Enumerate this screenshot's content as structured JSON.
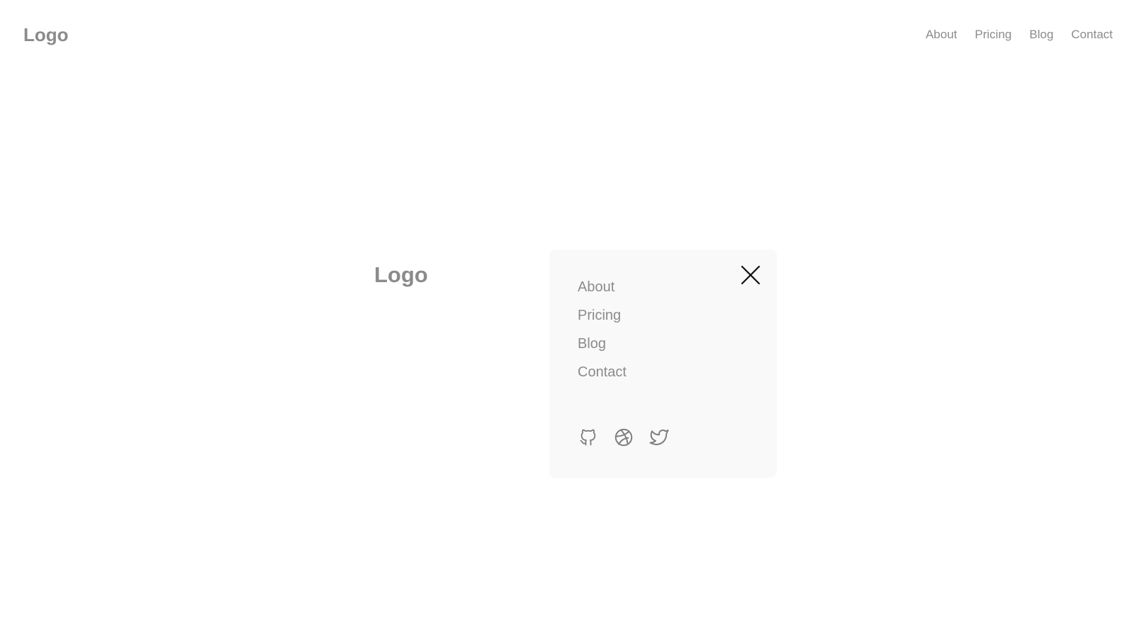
{
  "header": {
    "logo": "Logo",
    "nav": [
      {
        "label": "About"
      },
      {
        "label": "Pricing"
      },
      {
        "label": "Blog"
      },
      {
        "label": "Contact"
      }
    ]
  },
  "mobile_menu": {
    "logo": "Logo",
    "close_icon": "close-icon",
    "items": [
      {
        "label": "About"
      },
      {
        "label": "Pricing"
      },
      {
        "label": "Blog"
      },
      {
        "label": "Contact"
      }
    ],
    "socials": [
      {
        "icon": "github-icon"
      },
      {
        "icon": "dribbble-icon"
      },
      {
        "icon": "twitter-icon"
      }
    ]
  },
  "colors": {
    "text_muted": "#8b8b8b",
    "panel_bg": "#f9f9f9",
    "icon": "#7f7f7f",
    "close": "#111111"
  }
}
